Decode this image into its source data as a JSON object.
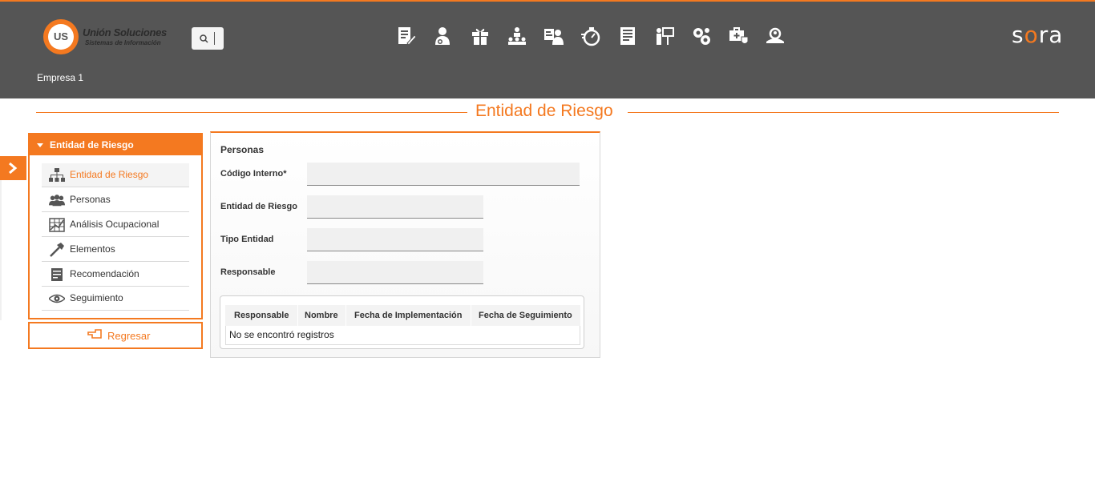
{
  "header": {
    "logo_title": "Unión Soluciones",
    "logo_subtitle": "Sistemas de Información",
    "logo_mark": "US",
    "brand": "sora",
    "company": "Empresa 1",
    "module_icons": [
      "edit-document-icon",
      "user-settings-icon",
      "gift-icon",
      "hierarchy-icon",
      "user-id-icon",
      "stopwatch-icon",
      "report-icon",
      "presentation-icon",
      "gears-icon",
      "medical-case-icon",
      "search-user-icon"
    ]
  },
  "page": {
    "title": "Entidad de Riesgo"
  },
  "sidebar": {
    "heading": "Entidad de Riesgo",
    "items": [
      {
        "label": "Entidad de Riesgo",
        "icon": "hierarchy-icon",
        "active": true
      },
      {
        "label": "Personas",
        "icon": "people-icon",
        "active": false
      },
      {
        "label": "Análisis Ocupacional",
        "icon": "chart-grid-icon",
        "active": false
      },
      {
        "label": "Elementos",
        "icon": "hammer-icon",
        "active": false
      },
      {
        "label": "Recomendación",
        "icon": "note-icon",
        "active": false
      },
      {
        "label": "Seguimiento",
        "icon": "eye-icon",
        "active": false
      }
    ],
    "back_label": "Regresar"
  },
  "form": {
    "section_title": "Personas",
    "fields": {
      "codigo": {
        "label": "Código Interno*",
        "value": ""
      },
      "entidad": {
        "label": "Entidad de Riesgo",
        "value": ""
      },
      "tipo": {
        "label": "Tipo Entidad",
        "value": ""
      },
      "responsable": {
        "label": "Responsable",
        "value": ""
      }
    }
  },
  "grid": {
    "columns": [
      "Responsable",
      "Nombre",
      "Fecha de Implementación",
      "Fecha de Seguimiento"
    ],
    "empty_text": "No se encontró registros"
  },
  "colors": {
    "accent": "#f47920",
    "header_bg": "#555555"
  }
}
